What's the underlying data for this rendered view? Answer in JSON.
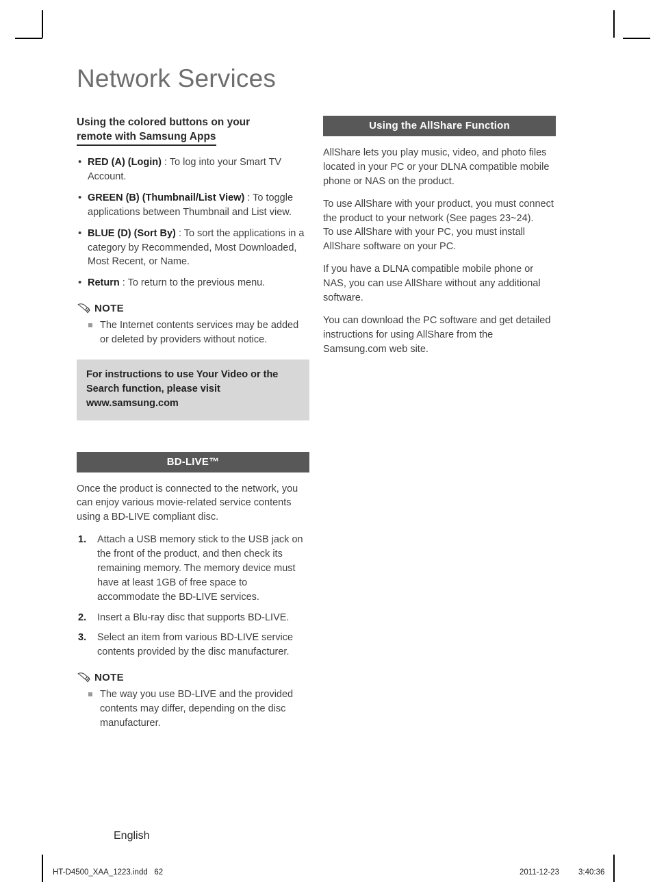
{
  "document": {
    "chapter_title": "Network Services",
    "language_label": "English",
    "footer": {
      "filename": "HT-D4500_XAA_1223.indd",
      "page_number": "62",
      "date": "2011-12-23",
      "time": "3:40:36"
    }
  },
  "colors": {
    "bar_background": "#585858",
    "bar_text": "#ffffff",
    "callout_background": "#d7d7d7",
    "title_gray": "#6e6e6e",
    "body_text": "#3f3f3f"
  },
  "left_column": {
    "heading": {
      "line1": "Using the colored buttons on your",
      "line2": "remote with Samsung Apps"
    },
    "button_items": [
      {
        "label": "RED (A) (Login)",
        "separator": " : ",
        "description": "To log into your Smart TV Account."
      },
      {
        "label": "GREEN (B) (Thumbnail/List View)",
        "separator": " : ",
        "description": "To toggle applications between Thumbnail and List view."
      },
      {
        "label": "BLUE (D) (Sort By)",
        "separator": " : ",
        "description": "To sort the applications in a category by Recommended, Most Downloaded, Most Recent, or Name."
      },
      {
        "label": "Return",
        "separator": " : ",
        "description": "To return to the previous menu."
      }
    ],
    "note_1": {
      "icon": "pencil-icon",
      "title": "NOTE",
      "items": [
        "The Internet contents services may be added or deleted by providers without notice."
      ]
    },
    "callout": "For instructions to use Your Video or the Search function, please visit www.samsung.com",
    "bdlive": {
      "bar_title": "BD-LIVE™",
      "intro": "Once the product is connected to the network, you can enjoy various movie-related service contents using a BD-LIVE compliant disc.",
      "steps": [
        {
          "number": "1.",
          "text": "Attach a USB memory stick to the USB jack on the front of the product, and then check its remaining memory. The memory device must have at least 1GB of free space to accommodate the BD-LIVE services."
        },
        {
          "number": "2.",
          "text": "Insert a Blu-ray disc that supports BD-LIVE."
        },
        {
          "number": "3.",
          "text": "Select an item from various BD-LIVE service contents provided by the disc manufacturer."
        }
      ]
    },
    "note_2": {
      "icon": "pencil-icon",
      "title": "NOTE",
      "items": [
        "The way you use BD-LIVE and the provided contents may differ, depending on the disc manufacturer."
      ]
    }
  },
  "right_column": {
    "bar_title": "Using the AllShare Function",
    "paragraphs": [
      "AllShare lets you play music, video, and photo files located in your PC or your DLNA compatible mobile phone or NAS on the product.",
      "To use AllShare with your product, you must connect the product to your network (See pages 23~24).",
      "To use AllShare with your PC, you must install AllShare software on your PC.",
      "If you have a DLNA compatible mobile phone or NAS, you can use AllShare without any additional software.",
      "You can download the PC software and get detailed instructions for using AllShare from the Samsung.com web site."
    ]
  }
}
